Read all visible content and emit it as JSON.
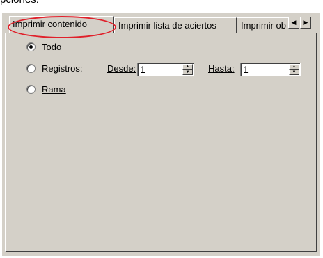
{
  "header_text": "pciones:",
  "tabs": [
    {
      "label": "Imprimir contenido",
      "active": true
    },
    {
      "label": "Imprimir lista de aciertos",
      "active": false
    },
    {
      "label": "Imprimir ob",
      "active": false
    }
  ],
  "scroll_buttons": {
    "left_glyph": "◀",
    "right_glyph": "▶"
  },
  "options": {
    "todo": {
      "label": "Todo",
      "selected": true
    },
    "registros": {
      "label": "Registros:",
      "selected": false
    },
    "rama": {
      "label": "Rama",
      "selected": false
    }
  },
  "range": {
    "desde_label": "Desde:",
    "desde_value": "1",
    "hasta_label": "Hasta:",
    "hasta_value": "1"
  },
  "spin_glyphs": {
    "up": "▲",
    "down": "▼"
  },
  "colors": {
    "dialog_bg": "#d4d0c8",
    "highlight": "#e0202a"
  }
}
